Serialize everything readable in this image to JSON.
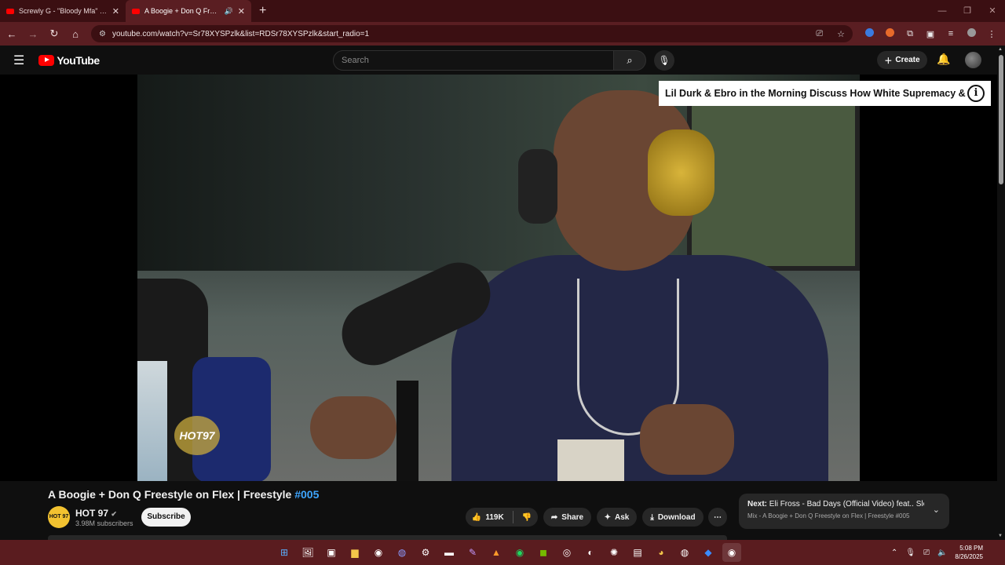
{
  "browser": {
    "tabs": [
      {
        "title": "Screwly G - \"Bloody Mfa\" (Offic",
        "active": false
      },
      {
        "title": "A Boogie + Don Q Freestyle",
        "active": true,
        "audio_icon": "speaker-icon"
      }
    ],
    "new_tab": "+",
    "url": "youtube.com/watch?v=Sr78XYSPzlk&list=RDSr78XYSPzlk&start_radio=1"
  },
  "youtube": {
    "logo_text": "YouTube",
    "search_placeholder": "Search",
    "create_label": "Create"
  },
  "player": {
    "watermark": "HOT 97",
    "endcard_title": "Lil Durk & Ebro in the Morning Discuss How White Supremacy & S...",
    "endcard_info": "i"
  },
  "video": {
    "title_main": "A Boogie + Don Q Freestyle on Flex | Freestyle",
    "title_tag": "#005",
    "channel": {
      "logo_text": "HOT 97",
      "name": "HOT 97",
      "subscribers": "3.98M subscribers",
      "subscribe_label": "Subscribe"
    },
    "actions": {
      "likes": "119K",
      "share": "Share",
      "ask": "Ask",
      "download": "Download"
    },
    "next": {
      "label": "Next:",
      "title": "Eli Fross - Bad Days (Official Video) feat.. Slee...",
      "subtitle": "Mix - A Boogie + Don Q Freestyle on Flex | Freestyle #005"
    }
  },
  "taskbar": {
    "time": "5:08 PM",
    "date": "8/26/2025"
  },
  "colors": {
    "accent_red": "#ff0000",
    "hashtag_blue": "#3ea6ff",
    "browser_frame": "#5a1e22"
  }
}
